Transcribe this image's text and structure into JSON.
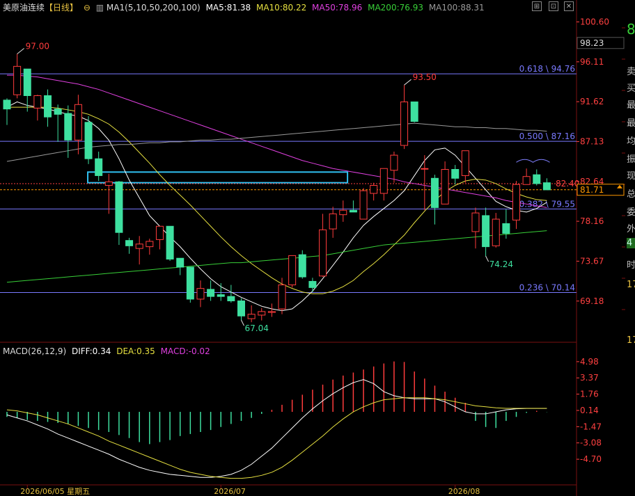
{
  "header": {
    "symbol": "美原油连续",
    "period": "【日线】",
    "ma_label": "MA1(5,10,50,200,100)",
    "ma5": "MA5:81.38",
    "ma10": "MA10:80.22",
    "ma50": "MA50:78.96",
    "ma200": "MA200:76.93",
    "ma100": "MA100:88.31"
  },
  "macd_header": {
    "label": "MACD(26,12,9)",
    "diff": "DIFF:0.34",
    "dea": "DEA:0.35",
    "macd": "MACD:-0.02"
  },
  "colors": {
    "up": "#ff3c3c",
    "down": "#3ee0a0",
    "ma5": "#ffffff",
    "ma10": "#e6e040",
    "ma50": "#e040e0",
    "ma200": "#38d038",
    "ma100": "#9a9a9a",
    "fib": "#7a7aff",
    "box": "#30c0f0",
    "price": "#ff9900",
    "axis": "#ff4040"
  },
  "sidebar_chars": [
    "8",
    "卖",
    "买",
    "最",
    "最",
    "均",
    "振",
    "现",
    "总",
    "委",
    "外",
    "4",
    "时",
    "17",
    "17"
  ],
  "chart_data": [
    {
      "type": "candlestick",
      "price_axis_labels": [
        "100.60",
        "96.11",
        "91.62",
        "87.13",
        "82.64",
        "78.16",
        "73.67",
        "69.18"
      ],
      "ylim": [
        64.7,
        101.5
      ],
      "current_price": "81.71",
      "crosshair_price": "98.23",
      "last_close_marker": "82.40",
      "annotations": [
        "97.00",
        "93.50",
        "67.04",
        "74.24"
      ],
      "fibonacci": [
        {
          "label": "0.618 \\ 94.76",
          "value": 94.76
        },
        {
          "label": "0.500 \\ 87.16",
          "value": 87.16
        },
        {
          "label": "0.382 \\ 79.55",
          "value": 79.55
        },
        {
          "label": "0.236 \\ 70.14",
          "value": 70.14
        }
      ],
      "ohlc": [
        [
          91.8,
          92.0,
          89.0,
          90.8
        ],
        [
          92.4,
          97.0,
          92.0,
          95.6
        ],
        [
          95.3,
          95.3,
          90.5,
          92.3
        ],
        [
          90.9,
          92.4,
          89.5,
          92.3
        ],
        [
          92.3,
          93.0,
          88.8,
          89.9
        ],
        [
          90.8,
          91.3,
          87.1,
          90.2
        ],
        [
          90.3,
          91.2,
          85.3,
          87.3
        ],
        [
          87.3,
          92.4,
          85.7,
          91.3
        ],
        [
          89.3,
          90.0,
          84.6,
          85.2
        ],
        [
          85.2,
          86.0,
          82.7,
          83.3
        ],
        [
          82.2,
          83.5,
          79.0,
          82.6
        ],
        [
          82.6,
          82.7,
          75.5,
          76.9
        ],
        [
          76.0,
          76.3,
          74.5,
          75.4
        ],
        [
          75.1,
          76.5,
          73.3,
          75.6
        ],
        [
          75.3,
          76.2,
          74.4,
          75.9
        ],
        [
          76.1,
          77.5,
          75.0,
          77.6
        ],
        [
          77.6,
          77.6,
          73.7,
          73.9
        ],
        [
          74.0,
          74.0,
          72.1,
          73.0
        ],
        [
          73.0,
          73.0,
          69.0,
          69.4
        ],
        [
          69.4,
          71.5,
          68.5,
          70.6
        ],
        [
          70.5,
          71.5,
          69.2,
          69.7
        ],
        [
          69.9,
          71.2,
          69.2,
          69.7
        ],
        [
          69.7,
          71.0,
          69.0,
          69.2
        ],
        [
          69.2,
          69.5,
          67.0,
          67.5
        ],
        [
          67.2,
          68.7,
          66.8,
          67.7
        ],
        [
          67.6,
          68.4,
          67.0,
          68.0
        ],
        [
          67.9,
          68.9,
          67.4,
          68.0
        ],
        [
          68.3,
          71.8,
          67.7,
          71.0
        ],
        [
          71.0,
          74.2,
          70.7,
          74.3
        ],
        [
          74.4,
          74.9,
          71.7,
          71.9
        ],
        [
          71.4,
          71.8,
          70.2,
          70.7
        ],
        [
          72.0,
          79.0,
          71.9,
          77.2
        ],
        [
          77.3,
          79.8,
          76.3,
          79.0
        ],
        [
          78.9,
          80.5,
          78.1,
          79.4
        ],
        [
          79.4,
          80.5,
          79.2,
          79.2
        ],
        [
          78.4,
          81.9,
          78.4,
          81.6
        ],
        [
          81.3,
          82.5,
          80.5,
          82.2
        ],
        [
          81.3,
          84.0,
          80.5,
          84.1
        ],
        [
          83.9,
          86.0,
          82.5,
          85.6
        ],
        [
          86.7,
          93.5,
          86.3,
          91.6
        ],
        [
          91.6,
          91.6,
          89.3,
          89.4
        ],
        [
          84.1,
          85.6,
          79.4,
          84.1
        ],
        [
          83.0,
          83.4,
          77.8,
          79.7
        ],
        [
          80.1,
          84.9,
          80.1,
          84.0
        ],
        [
          84.0,
          84.5,
          82.3,
          83.0
        ],
        [
          83.3,
          86.1,
          82.5,
          86.1
        ],
        [
          77.0,
          79.7,
          75.1,
          79.1
        ],
        [
          78.8,
          79.7,
          74.2,
          75.3
        ],
        [
          75.4,
          79.1,
          75.2,
          78.4
        ],
        [
          77.9,
          79.5,
          76.2,
          76.8
        ],
        [
          78.3,
          82.7,
          77.3,
          82.3
        ],
        [
          82.3,
          84.1,
          82.3,
          83.2
        ],
        [
          83.4,
          84.0,
          82.2,
          82.4
        ],
        [
          82.5,
          83.0,
          81.8,
          81.7
        ]
      ],
      "ma_series": [
        {
          "name": "MA5",
          "values": [
            91.0,
            91.6,
            91.2,
            91.0,
            90.8,
            90.5,
            90.2,
            90.0,
            89.5,
            88.6,
            87.3,
            85.2,
            82.8,
            80.8,
            78.8,
            77.6,
            76.4,
            75.3,
            74.0,
            72.8,
            71.7,
            70.8,
            70.2,
            69.6,
            69.1,
            68.6,
            68.3,
            68.1,
            68.3,
            69.2,
            70.3,
            71.7,
            73.2,
            74.7,
            76.3,
            77.7,
            78.7,
            79.6,
            80.5,
            81.6,
            83.3,
            85.0,
            86.2,
            86.4,
            85.6,
            84.3,
            83.0,
            81.7,
            80.4,
            79.8,
            79.4,
            79.2,
            79.6,
            80.3
          ]
        },
        {
          "name": "MA10",
          "values": [
            91.0,
            91.0,
            91.0,
            91.0,
            91.0,
            90.9,
            90.7,
            90.5,
            90.2,
            89.7,
            89.1,
            88.2,
            87.1,
            85.9,
            84.7,
            83.4,
            82.2,
            81.1,
            80.0,
            78.8,
            77.6,
            76.4,
            75.3,
            74.3,
            73.4,
            72.6,
            71.8,
            71.1,
            70.6,
            70.2,
            70.0,
            70.0,
            70.3,
            70.8,
            71.5,
            72.5,
            73.4,
            74.4,
            75.5,
            76.6,
            78.0,
            79.3,
            80.5,
            81.5,
            82.2,
            82.7,
            82.9,
            82.8,
            82.4,
            81.8,
            81.3,
            80.9,
            80.6,
            80.5
          ]
        },
        {
          "name": "MA50",
          "values": [
            94.6,
            94.6,
            94.5,
            94.4,
            94.2,
            94.0,
            93.8,
            93.6,
            93.3,
            93.0,
            92.6,
            92.2,
            91.8,
            91.4,
            91.0,
            90.6,
            90.2,
            89.8,
            89.4,
            89.0,
            88.6,
            88.2,
            87.8,
            87.4,
            87.0,
            86.6,
            86.2,
            85.8,
            85.4,
            85.0,
            84.7,
            84.4,
            84.1,
            83.9,
            83.7,
            83.5,
            83.3,
            83.1,
            82.9,
            82.6,
            82.4,
            82.2,
            82.0,
            81.8,
            81.6,
            81.4,
            81.2,
            81.0,
            80.8,
            80.5,
            80.3,
            80.1,
            79.9,
            79.7
          ]
        },
        {
          "name": "MA200",
          "values": [
            71.3,
            71.4,
            71.5,
            71.6,
            71.7,
            71.8,
            71.9,
            72.0,
            72.1,
            72.2,
            72.3,
            72.4,
            72.5,
            72.6,
            72.7,
            72.8,
            72.9,
            73.0,
            73.1,
            73.2,
            73.3,
            73.4,
            73.5,
            73.5,
            73.6,
            73.7,
            73.8,
            73.9,
            74.0,
            74.1,
            74.2,
            74.3,
            74.5,
            74.7,
            74.9,
            75.1,
            75.3,
            75.5,
            75.6,
            75.7,
            75.8,
            75.9,
            76.0,
            76.1,
            76.2,
            76.3,
            76.4,
            76.5,
            76.6,
            76.7,
            76.8,
            76.9,
            77.0,
            77.1
          ]
        },
        {
          "name": "MA100",
          "values": [
            84.9,
            85.1,
            85.3,
            85.5,
            85.7,
            85.9,
            86.1,
            86.3,
            86.5,
            86.6,
            86.7,
            86.8,
            86.8,
            86.9,
            87.0,
            87.0,
            87.1,
            87.1,
            87.2,
            87.3,
            87.3,
            87.4,
            87.4,
            87.5,
            87.6,
            87.7,
            87.8,
            87.9,
            88.0,
            88.1,
            88.2,
            88.3,
            88.4,
            88.5,
            88.6,
            88.7,
            88.8,
            88.9,
            89.0,
            89.1,
            89.2,
            89.1,
            89.0,
            88.9,
            88.8,
            88.8,
            88.7,
            88.7,
            88.6,
            88.6,
            88.5,
            88.4,
            88.4,
            88.3
          ]
        }
      ],
      "x_labels": [
        {
          "text": "2026/06/05 星期五",
          "index": 2
        },
        {
          "text": "2026/07",
          "index": 21
        },
        {
          "text": "2026/08",
          "index": 44
        }
      ]
    },
    {
      "type": "macd",
      "axis_labels": [
        "4.98",
        "3.37",
        "1.76",
        "0.14",
        "-1.47",
        "-3.08",
        "-4.70"
      ],
      "ylim": [
        -6.9,
        5.8
      ],
      "histogram": [
        -0.5,
        -0.6,
        -0.8,
        -0.9,
        -1.0,
        -1.1,
        -1.2,
        -1.4,
        -1.6,
        -1.8,
        -2.0,
        -2.3,
        -2.6,
        -3.0,
        -3.2,
        -3.0,
        -2.8,
        -2.4,
        -2.2,
        -2.0,
        -1.8,
        -1.5,
        -1.2,
        -0.9,
        -0.6,
        -0.2,
        0.2,
        0.7,
        1.2,
        1.7,
        2.2,
        2.7,
        3.2,
        3.6,
        3.9,
        4.2,
        4.5,
        4.8,
        5.0,
        4.95,
        4.0,
        3.3,
        2.6,
        2.0,
        1.4,
        0.9,
        -0.9,
        -1.5,
        -1.6,
        -0.9,
        -0.5,
        -0.1,
        0.1,
        -0.02
      ],
      "diff": [
        -0.3,
        -0.6,
        -0.9,
        -1.3,
        -1.7,
        -2.2,
        -2.6,
        -3.0,
        -3.4,
        -3.8,
        -4.2,
        -4.7,
        -5.1,
        -5.5,
        -5.8,
        -6.0,
        -6.2,
        -6.3,
        -6.4,
        -6.5,
        -6.5,
        -6.4,
        -6.2,
        -5.8,
        -5.2,
        -4.4,
        -3.6,
        -2.6,
        -1.6,
        -0.6,
        0.3,
        1.1,
        1.8,
        2.4,
        2.9,
        3.2,
        2.8,
        2.0,
        1.6,
        1.4,
        1.3,
        1.3,
        1.3,
        1.0,
        0.5,
        0.0,
        -0.2,
        -0.2,
        0.0,
        0.2,
        0.3,
        0.34,
        0.34,
        0.34
      ],
      "dea": [
        0.2,
        0.1,
        -0.1,
        -0.3,
        -0.6,
        -0.9,
        -1.2,
        -1.6,
        -2.0,
        -2.4,
        -2.9,
        -3.3,
        -3.7,
        -4.1,
        -4.5,
        -4.9,
        -5.3,
        -5.7,
        -6.0,
        -6.2,
        -6.4,
        -6.5,
        -6.6,
        -6.6,
        -6.5,
        -6.3,
        -6.0,
        -5.5,
        -4.8,
        -4.0,
        -3.2,
        -2.4,
        -1.5,
        -0.7,
        0.0,
        0.5,
        0.9,
        1.2,
        1.3,
        1.4,
        1.4,
        1.4,
        1.3,
        1.2,
        1.0,
        0.8,
        0.6,
        0.5,
        0.4,
        0.35,
        0.35,
        0.35,
        0.35,
        0.35
      ]
    }
  ]
}
